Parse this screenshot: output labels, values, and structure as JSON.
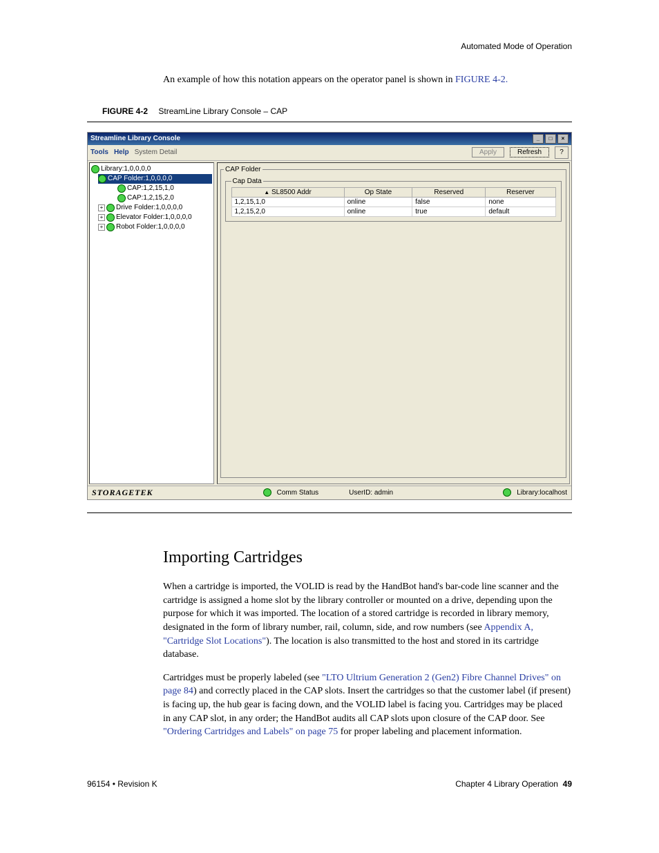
{
  "header": {
    "right": "Automated Mode of Operation"
  },
  "intro": {
    "text_before_link": "An example of how this notation appears on the operator panel is shown in ",
    "link": "FIGURE 4-2.",
    "after": ""
  },
  "figure": {
    "label": "FIGURE 4-2",
    "caption": "StreamLine Library Console – CAP"
  },
  "app": {
    "title": "Streamline Library Console",
    "menubar": {
      "tools": "Tools",
      "help": "Help",
      "system_detail": "System Detail",
      "apply": "Apply",
      "refresh": "Refresh"
    },
    "tree": {
      "root": "Library:1,0,0,0,0",
      "cap_folder": "CAP Folder:1,0,0,0,0",
      "cap1": "CAP:1,2,15,1,0",
      "cap2": "CAP:1,2,15,2,0",
      "drive_folder": "Drive Folder:1,0,0,0,0",
      "elevator_folder": "Elevator Folder:1,0,0,0,0",
      "robot_folder": "Robot Folder:1,0,0,0,0"
    },
    "panel": {
      "cap_folder_legend": "CAP Folder",
      "cap_data_legend": "Cap Data",
      "columns": {
        "addr": "SL8500 Addr",
        "op_state": "Op State",
        "reserved": "Reserved",
        "reserver": "Reserver"
      },
      "rows": [
        {
          "addr": "1,2,15,1,0",
          "op_state": "online",
          "reserved": "false",
          "reserver": "none"
        },
        {
          "addr": "1,2,15,2,0",
          "op_state": "online",
          "reserved": "true",
          "reserver": "default"
        }
      ]
    },
    "statusbar": {
      "brand": "STORAGETEK",
      "comm": "Comm Status",
      "userid_label": "UserID: admin",
      "library": "Library:localhost"
    }
  },
  "section": {
    "heading": "Importing Cartridges",
    "p1_before": "When a cartridge is imported, the VOLID is read by the HandBot hand's bar-code line scanner and the cartridge is assigned a home slot by the library controller or mounted on a drive, depending upon the purpose for which it was imported. The location of a stored cartridge is recorded in library memory, designated in the form of library number, rail, column, side, and row numbers (see ",
    "p1_link1": "Appendix A, \"Cartridge Slot Locations\"",
    "p1_after1": "). The location is also transmitted to the host and stored in its cartridge database.",
    "p2_before": "Cartridges must be properly labeled (see ",
    "p2_link1": "\"LTO Ultrium Generation 2 (Gen2) Fibre Channel Drives\" on page 84",
    "p2_mid": ") and correctly placed in the CAP slots. Insert the cartridges so that the customer label (if present) is facing up, the hub gear is facing down, and the VOLID label is facing you. Cartridges may be placed in any CAP slot, in any order; the HandBot audits all CAP slots upon closure of the CAP door. See ",
    "p2_link2": "\"Ordering Cartridges and Labels\" on page 75",
    "p2_after": " for proper labeling and placement information."
  },
  "footer": {
    "left": "96154 • Revision K",
    "right_text": "Chapter 4 Library Operation",
    "page_no": "49"
  }
}
